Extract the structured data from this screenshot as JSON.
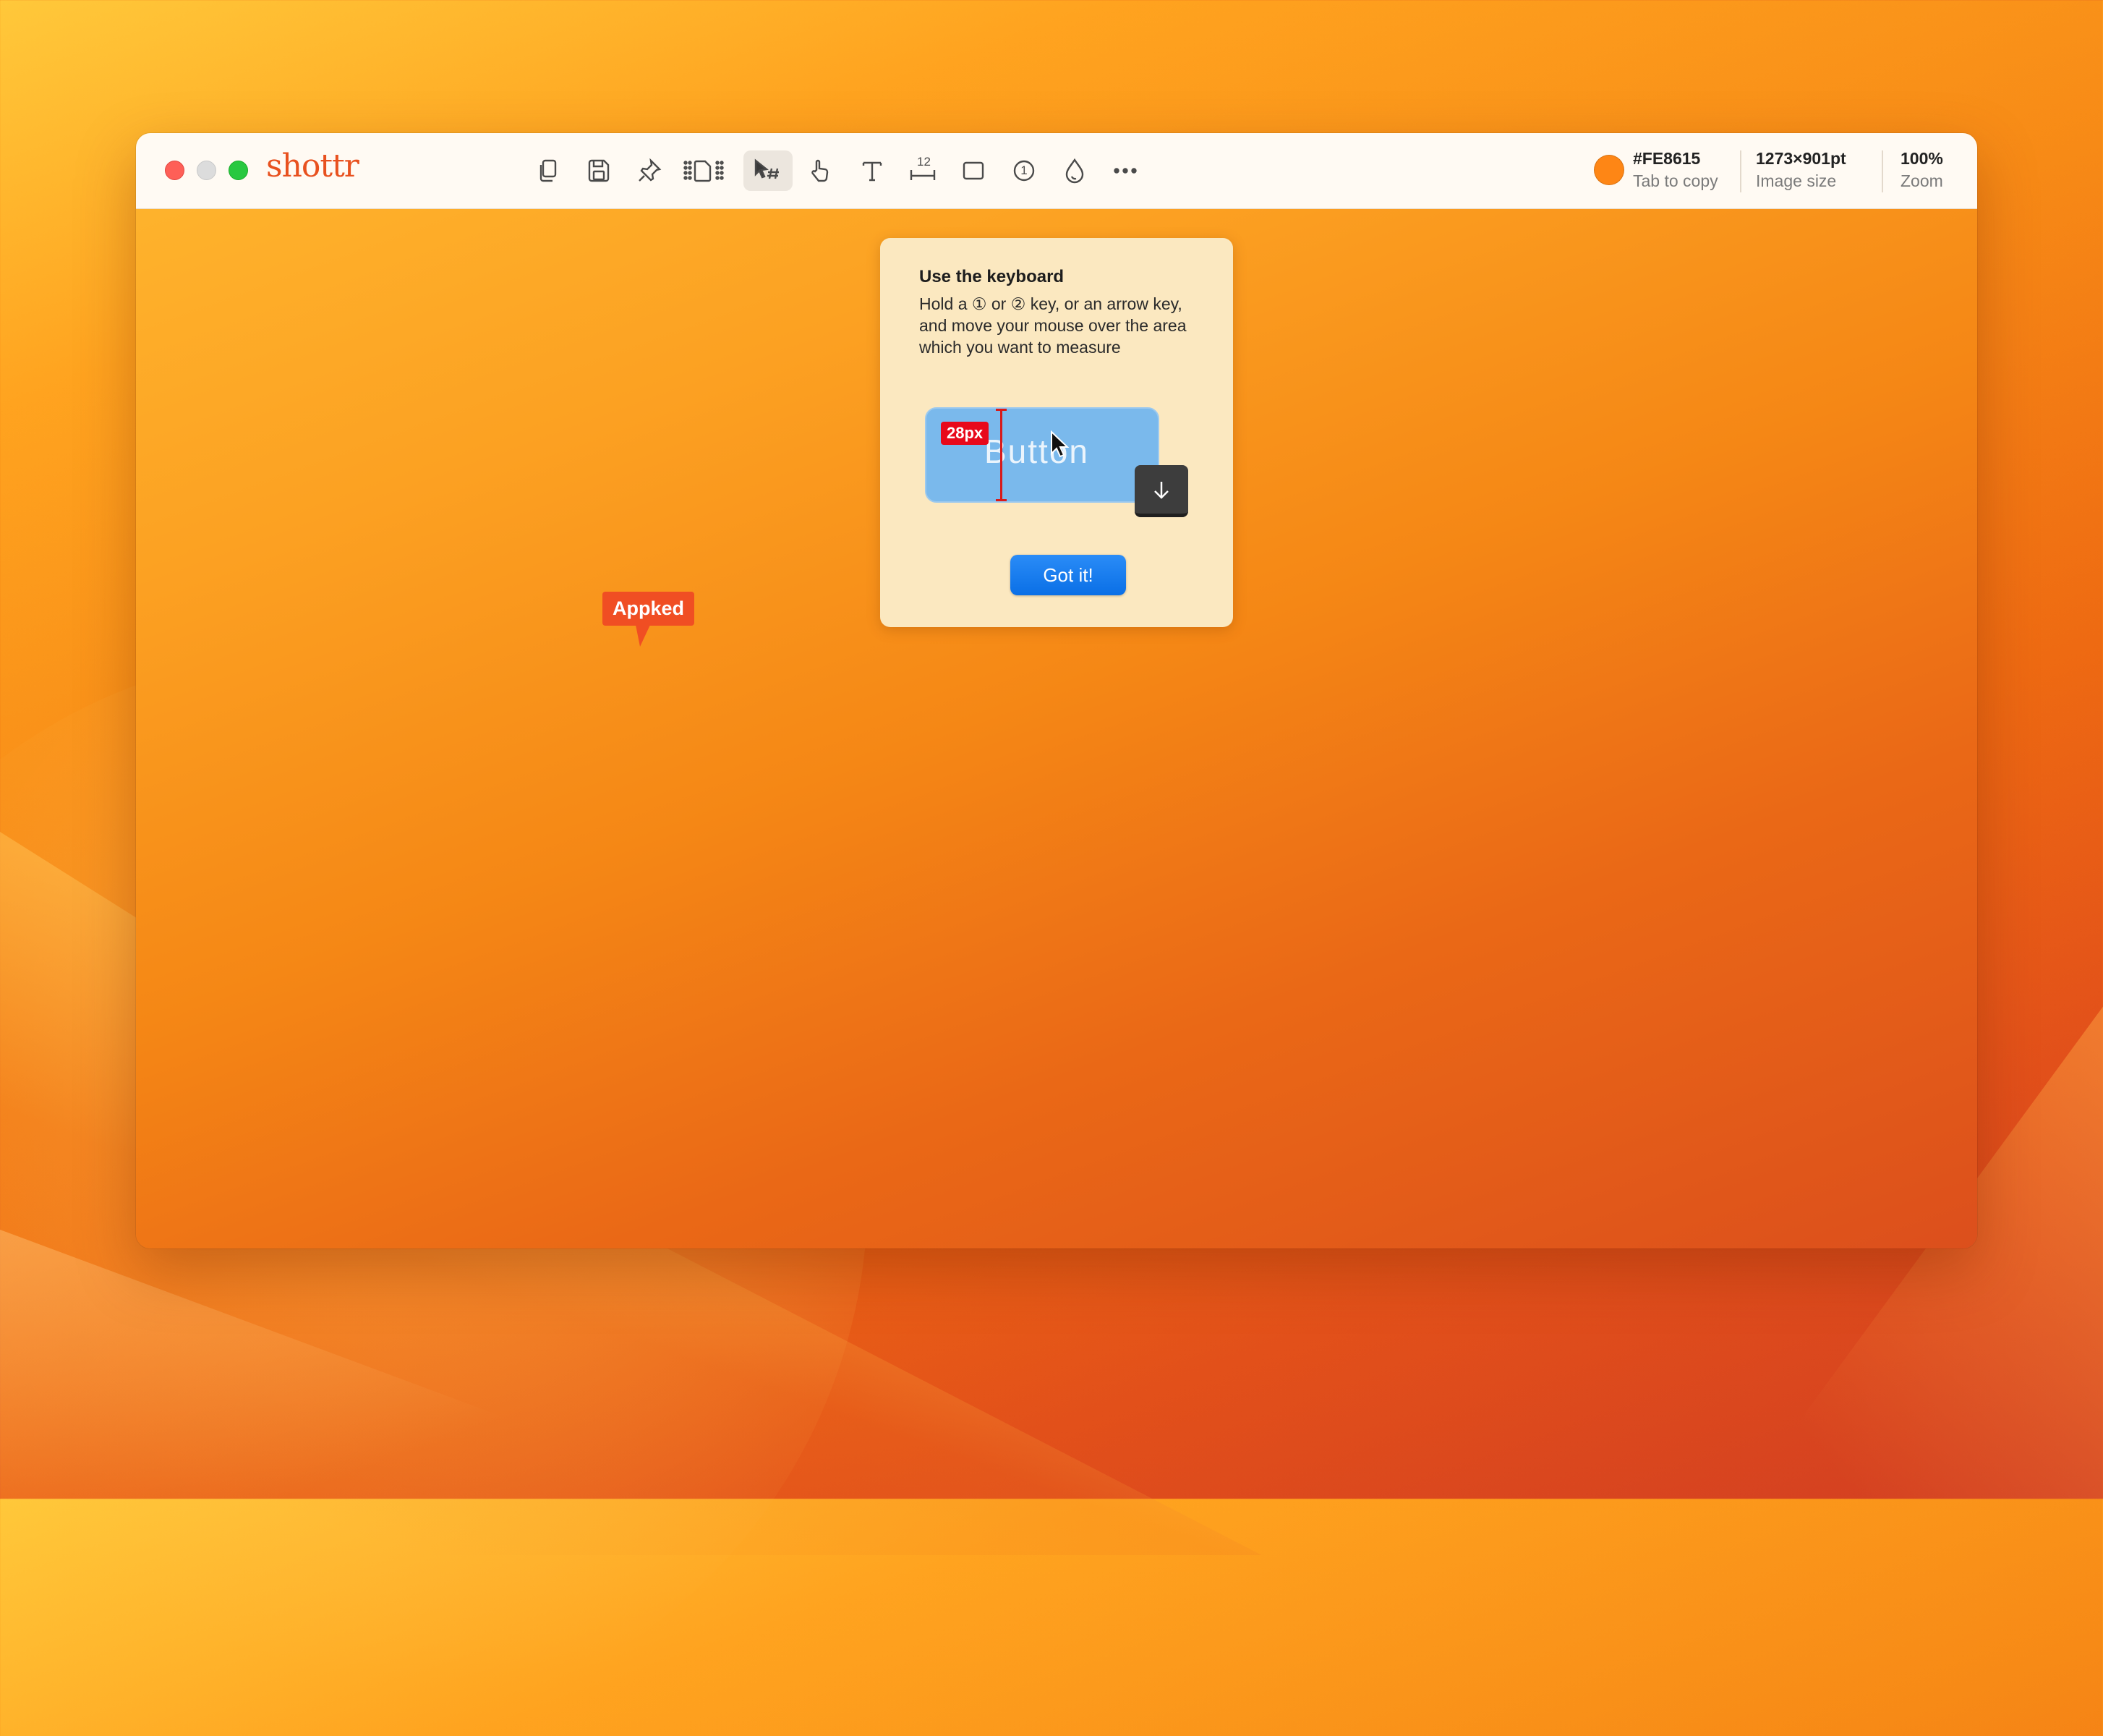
{
  "app": {
    "name": "shottr"
  },
  "toolbar": {
    "tools": [
      {
        "name": "copy-icon"
      },
      {
        "name": "save-icon"
      },
      {
        "name": "pin-icon"
      },
      {
        "name": "expand-canvas-icon"
      },
      {
        "name": "select-arrow-icon",
        "active": true
      },
      {
        "name": "hand-icon"
      },
      {
        "name": "text-icon"
      },
      {
        "name": "ruler-icon",
        "label": "12"
      },
      {
        "name": "rectangle-icon"
      },
      {
        "name": "step-counter-icon",
        "label": "1"
      },
      {
        "name": "color-picker-drop-icon"
      },
      {
        "name": "more-icon"
      }
    ],
    "color": {
      "value": "#FE8615",
      "label": "Tab to copy",
      "swatch": "#FE8615"
    },
    "image_size": {
      "value": "1273×901pt",
      "label": "Image size"
    },
    "zoom": {
      "value": "100%",
      "label": "Zoom"
    }
  },
  "tip": {
    "title": "Use the keyboard",
    "body": "Hold a ① or ② key, or an arrow key, and move your mouse over the area which you want to measure",
    "demo": {
      "button_text": "Button",
      "measure_badge": "28px",
      "key": "down-arrow-key-icon"
    },
    "confirm_label": "Got  it!"
  },
  "overlay": {
    "watermark_label": "Appked"
  },
  "colors": {
    "brand": "#E8511F",
    "accent_blue": "#0A6FE6",
    "measure_red": "#E8091B",
    "tip_bg": "#FBE8C0"
  }
}
